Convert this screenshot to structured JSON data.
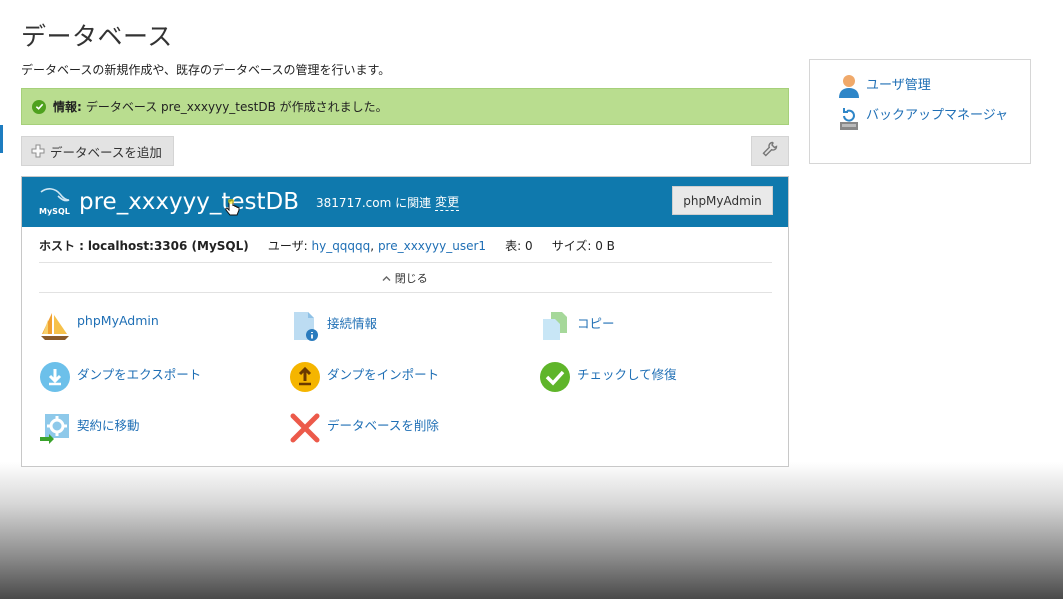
{
  "page": {
    "title": "データベース",
    "description": "データベースの新規作成や、既存のデータベースの管理を行います。"
  },
  "notice": {
    "label": "情報:",
    "message": "データベース pre_xxxyyy_testDB が作成されました。"
  },
  "toolbar": {
    "add_label": "データベースを追加"
  },
  "database": {
    "name": "pre_xxxyyy_testDB",
    "domain": "381717.com に関連",
    "change_label": "変更",
    "phpmyadmin_button": "phpMyAdmin",
    "icon_text": "MySQL",
    "host_label": "ホスト :",
    "host_value": "localhost:3306 (MySQL)",
    "users_label": "ユーザ:",
    "user1": "hy_qqqqq",
    "user_sep": ",",
    "user2": "pre_xxxyyy_user1",
    "tables_label": "表:",
    "tables_value": "0",
    "size_label": "サイズ:",
    "size_value": "0 B",
    "collapse_label": "閉じる"
  },
  "actions": {
    "phpmyadmin": "phpMyAdmin",
    "connection_info": "接続情報",
    "copy": "コピー",
    "export_dump": "ダンプをエクスポート",
    "import_dump": "ダンプをインポート",
    "check_repair": "チェックして修復",
    "move_subscription": "契約に移動",
    "delete_db": "データベースを削除"
  },
  "sidebar": {
    "user_management": "ユーザ管理",
    "backup_manager": "バックアップマネージャ"
  },
  "colors": {
    "header_blue": "#0f79ad",
    "notice_green": "#b9dd8f",
    "link_blue": "#1f6fb5"
  }
}
